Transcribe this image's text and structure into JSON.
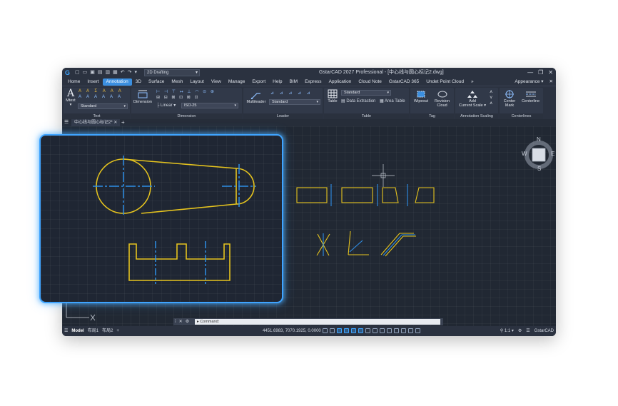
{
  "app": {
    "title": "GstarCAD 2027 Professional - [中心线与圆心标记2.dwg]",
    "workspace": "2D Drafting",
    "accent": "#3b8fe0"
  },
  "menu": {
    "tabs": [
      "Home",
      "Insert",
      "Annotation",
      "3D",
      "Surface",
      "Mesh",
      "Layout",
      "View",
      "Manage",
      "Export",
      "Help",
      "BIM",
      "Express",
      "Application",
      "Cloud Note",
      "GstarCAD 365",
      "Undet Point Cloud"
    ],
    "active": "Annotation",
    "overflow": "»",
    "appearance": "Appearance"
  },
  "ribbon": {
    "text": {
      "label": "Text",
      "mtext": "Mtext",
      "style": "Standard"
    },
    "dimension": {
      "label": "Dimension",
      "button": "Dimension",
      "linear": "Linear",
      "style": "ISO-25"
    },
    "leader": {
      "label": "Leader",
      "button": "Multileader",
      "style": "Standard"
    },
    "table": {
      "label": "Table",
      "button": "Table",
      "style": "Standard",
      "data_extraction": "Data Extraction",
      "area_table": "Area Table"
    },
    "tag": {
      "label": "Tag",
      "wipeout": "Wipeout",
      "revision_1": "Revision",
      "revision_2": "Cloud"
    },
    "scaling": {
      "label": "Annotation Scaling",
      "add_1": "Add",
      "add_2": "Current Scale"
    },
    "centerlines": {
      "label": "Centerlines",
      "mark_1": "Center",
      "mark_2": "Mark",
      "centerline": "Centerline"
    }
  },
  "doc": {
    "tab": "中心线与圆心标记2*"
  },
  "viewcube": {
    "n": "N",
    "w": "W",
    "e": "E",
    "s": "S"
  },
  "command": {
    "prompt": "Command:"
  },
  "status": {
    "model": "Model",
    "layout1": "布局1",
    "layout2": "布局2",
    "coords": "4451.6983, 7070.1925, 0.0000",
    "scale": "1:1",
    "app": "GstarCAD"
  },
  "colors": {
    "geometry": "#e6c41e",
    "centerline": "#2f8fe8",
    "highlight": "#3fa4ff"
  }
}
